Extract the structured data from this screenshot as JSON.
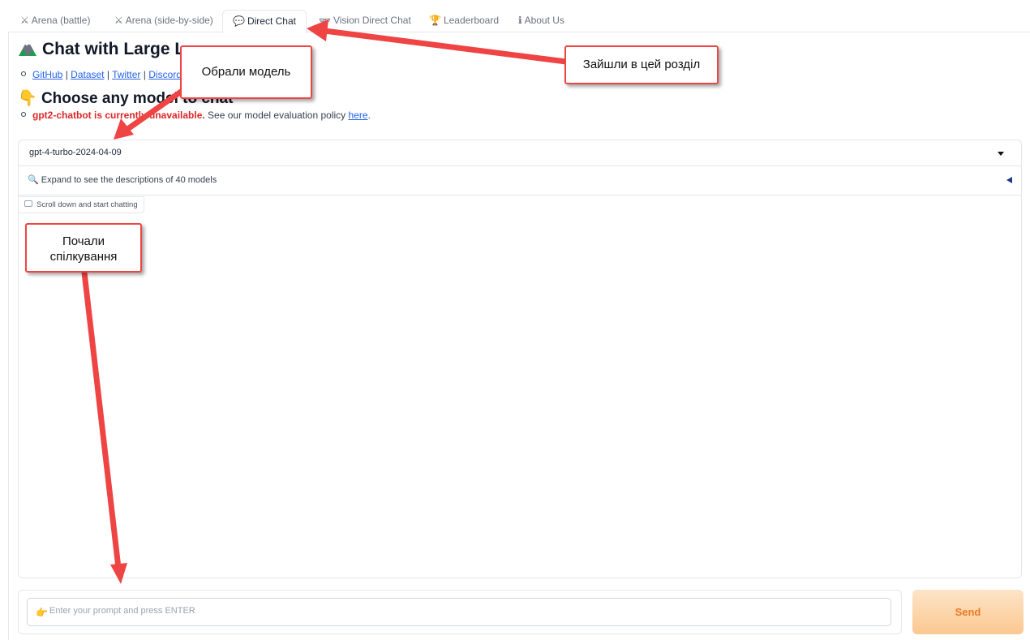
{
  "tabs": [
    {
      "label": "Arena (battle)",
      "icon": "crossed-swords-icon"
    },
    {
      "label": "Arena (side-by-side)",
      "icon": "crossed-swords-icon"
    },
    {
      "label": "Direct Chat",
      "icon": "speech-bubble-icon"
    },
    {
      "label": "Vision Direct Chat",
      "icon": "glasses-icon"
    },
    {
      "label": "Leaderboard",
      "icon": "trophy-icon"
    },
    {
      "label": "About Us",
      "icon": "info-icon"
    }
  ],
  "active_tab": "Direct Chat",
  "header": {
    "title": "Chat with Large L",
    "links": [
      "GitHub",
      "Dataset",
      "Twitter",
      "Discord"
    ],
    "subtitle": "Choose any model to chat",
    "warning_red": "gpt2-chatbot is currently unavailable.",
    "warning_rest": " See our model evaluation policy ",
    "warning_link": "here",
    "warning_end": "."
  },
  "model_select": {
    "value": "gpt-4-turbo-2024-04-09"
  },
  "descriptions": {
    "label": "Expand to see the descriptions of 40 models"
  },
  "chat": {
    "label": "Scroll down and start chatting"
  },
  "prompt": {
    "placeholder": "Enter your prompt and press ENTER",
    "value": ""
  },
  "send_label": "Send",
  "annotations": {
    "section": "Зайшли в цей розділ",
    "model": "Обрали модель",
    "chat_line1": "Почали",
    "chat_line2": "спілкування"
  },
  "colors": {
    "annotation": "#ef4444",
    "warning": "#dc2626",
    "send_text": "#ea7a26",
    "link": "#2563eb"
  }
}
